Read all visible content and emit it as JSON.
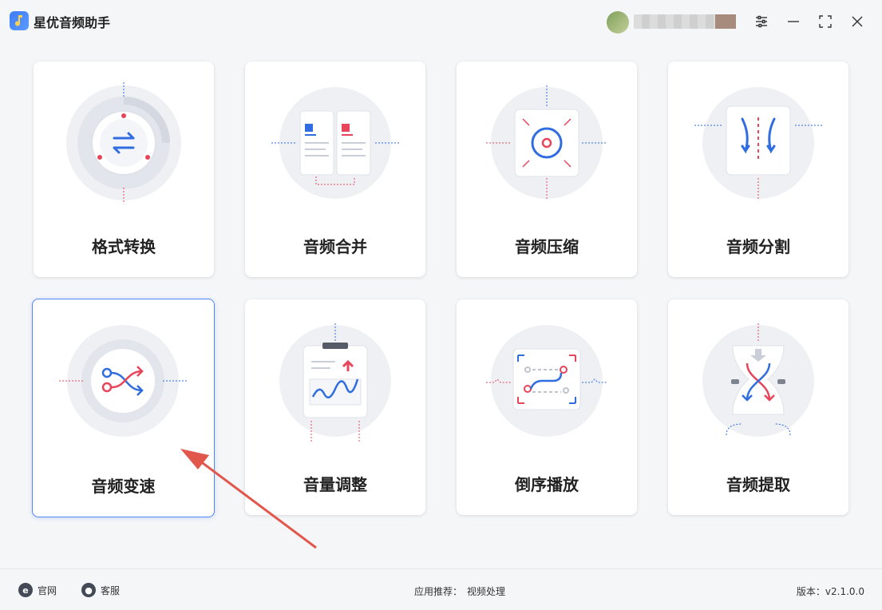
{
  "app": {
    "title": "星优音频助手"
  },
  "window_controls": {
    "settings": "settings-icon",
    "minimize": "minimize-icon",
    "maximize": "maximize-icon",
    "close": "close-icon"
  },
  "tools": [
    {
      "label": "格式转换",
      "icon": "format-convert-icon"
    },
    {
      "label": "音频合并",
      "icon": "audio-merge-icon"
    },
    {
      "label": "音频压缩",
      "icon": "audio-compress-icon"
    },
    {
      "label": "音频分割",
      "icon": "audio-split-icon"
    },
    {
      "label": "音频变速",
      "icon": "audio-speed-icon"
    },
    {
      "label": "音量调整",
      "icon": "volume-adjust-icon"
    },
    {
      "label": "倒序播放",
      "icon": "reverse-play-icon"
    },
    {
      "label": "音频提取",
      "icon": "audio-extract-icon"
    }
  ],
  "footer": {
    "website_label": "官网",
    "support_label": "客服",
    "recommend_label": "应用推荐：",
    "recommend_link": "视频处理",
    "version": "版本：v2.1.0.0"
  },
  "colors": {
    "accent": "#4f87f6",
    "red": "#e8455a",
    "blue": "#2f6de0",
    "annotation_arrow": "#e2574c"
  }
}
